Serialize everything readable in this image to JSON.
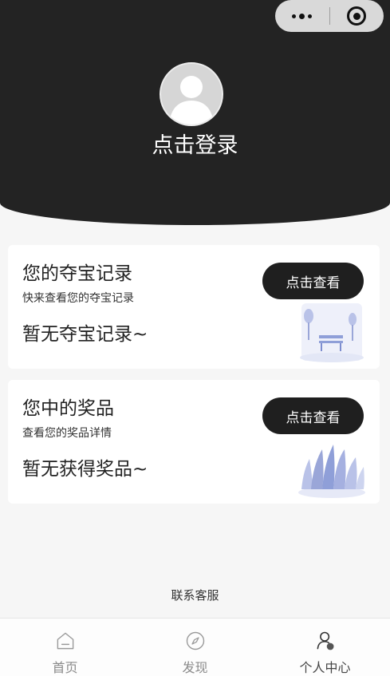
{
  "header": {
    "login_label": "点击登录"
  },
  "capsule": {
    "more_icon": "more-dots-icon",
    "close_icon": "target-circle-icon"
  },
  "cards": [
    {
      "title": "您的夺宝记录",
      "subtitle": "快来查看您的夺宝记录",
      "empty_text": "暂无夺宝记录~",
      "button_label": "点击查看",
      "illustration": "park-bench-illustration"
    },
    {
      "title": "您中的奖品",
      "subtitle": "查看您的奖品详情",
      "empty_text": "暂无获得奖品~",
      "button_label": "点击查看",
      "illustration": "grass-illustration"
    }
  ],
  "footer": {
    "service_label": "联系客服"
  },
  "tabbar": {
    "items": [
      {
        "label": "首页",
        "icon": "home-icon",
        "active": false
      },
      {
        "label": "发现",
        "icon": "compass-icon",
        "active": false
      },
      {
        "label": "个人中心",
        "icon": "profile-icon",
        "active": true
      }
    ]
  },
  "colors": {
    "header_bg": "#232323",
    "button_bg": "#1f1f1f",
    "page_bg": "#f6f6f6",
    "illustration_accent": "#8f9fd8"
  }
}
